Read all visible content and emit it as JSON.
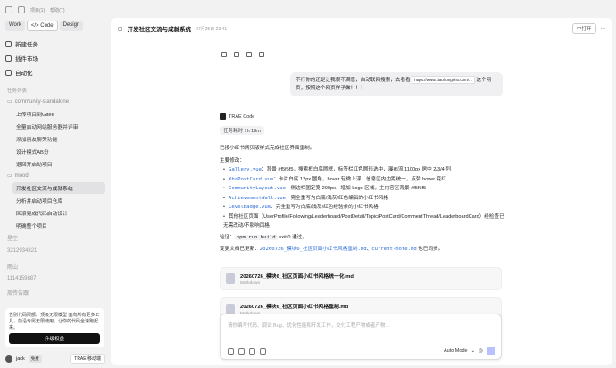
{
  "titlebar": {
    "left_text": "项目(1)",
    "right_text": "帮助(T)"
  },
  "mode_tabs": [
    "Work",
    "</> Code",
    "Design"
  ],
  "nav": {
    "new_task": "新建任务",
    "market": "插件市场",
    "automation": "自动化"
  },
  "tasks_label": "任务列表",
  "groups": {
    "community": "community-standalone",
    "mood": "mood"
  },
  "community_tasks": [
    "上传项目到Gitee",
    "全量启动网站服务器并评审",
    "添加朋友聊天功能",
    "设计模式AB分",
    "退回开启动项目"
  ],
  "mood_tasks": [
    "开发社区交流与成就系统",
    "分析并启动项目仓库",
    "回滚完成代码启动设计",
    "明确整个项目"
  ],
  "other_groups": [
    "星空",
    "3212934821",
    "雨山",
    "1114159887",
    "周传告跟"
  ],
  "promo": {
    "text": "告别代码限额。顶级无限模型 面向所有更多工具，前沿专属无限使用，让你的代码全速跑起来。",
    "button": "升级权益"
  },
  "user": {
    "name": "jack",
    "badge": "免费",
    "right": "TRAE 移动端"
  },
  "main": {
    "title": "开发社区交流与成就系统",
    "timestamp": "07月25日 23:41",
    "open_label": "中打开",
    "user_message_pre": "不行你的还是让我很不满意，启动联网搜索，去看看",
    "user_message_link": "https://www.xiaohongshu.com/...",
    "user_message_post": "这个网页，按照这个网页样子做！！！",
    "agent_name": "TRAE Code",
    "task_time": "任务耗时 1h 19m",
    "summary_intro": "已按小红书网页版样式完成社区界面重制。",
    "summary_heading": "主要修改：",
    "changes": [
      {
        "file": "Gallery.vue",
        "desc": "：背景 #f5f5f5，搜索框白底圆框，标签栏红色圆形选中，瀑布流 1100px 居中 2/3/4 列"
      },
      {
        "file": "XhsPostCard.vue",
        "desc": "：卡片白底 12px 圆角，hover 轻微上浮，信息区内边距统一，点赞 hover 变红"
      },
      {
        "file": "CommunityLayout.vue",
        "desc": "：侧边栏固定宽 200px，增加 Logo 区域，主内容区背景 #f5f5f5"
      },
      {
        "file": "AchievementWall.vue",
        "desc": "：完全重写为白底/浅灰/红色编辑的小红书风格"
      },
      {
        "file": "LevelBadge.vue",
        "desc": "：完全重写为白底/浅灰/红色经验条的小红书风格"
      },
      {
        "file": "",
        "desc": "其他社区页面（UserProfile/Following/Leaderboard/PostDetail/Topic/PostCard/CommentThread/LeaderboardCard）经检查已无需改动/不影响风格"
      }
    ],
    "verify_pre": "验证：",
    "verify_cmd": "npm run build",
    "verify_post": " exit 0 通过。",
    "docs_pre": "变更文档已更新：",
    "docs_file1": "20260726_模块6_社区页面小红书风格重制.md",
    "docs_sep": "、",
    "docs_file2": "current-note.md",
    "docs_post": " 也已同步。",
    "files": [
      {
        "name": "20260726_模块6_社区页面小红书风格统一化.md",
        "type": "Markdown"
      },
      {
        "name": "20260726_模块6_社区页面小红书风格重制.md",
        "type": "Markdown"
      }
    ],
    "input_placeholder": "请你编写代码、调试 Bug、优化性能和开发工作，交付工程产物或者产物...",
    "mode_select": "Auto Mode"
  }
}
